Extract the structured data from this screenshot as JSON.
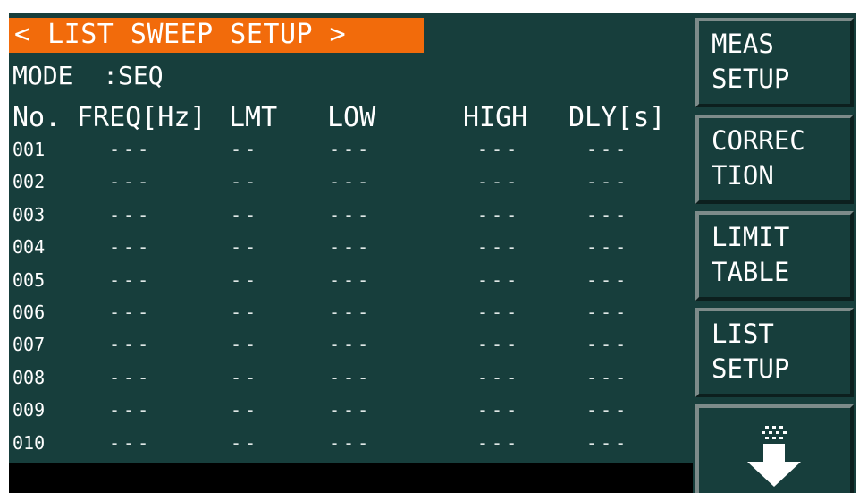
{
  "title": "< LIST SWEEP SETUP >",
  "mode": "MODE  :SEQ",
  "columns": {
    "no": "No.",
    "freq": "FREQ[Hz]",
    "lmt": "LMT",
    "low": "LOW",
    "high": "HIGH",
    "dly": "DLY[s]"
  },
  "rows": [
    {
      "index": "001",
      "freq": "---",
      "lmt": "--",
      "low": "---",
      "high": "---",
      "dly": "---"
    },
    {
      "index": "002",
      "freq": "---",
      "lmt": "--",
      "low": "---",
      "high": "---",
      "dly": "---"
    },
    {
      "index": "003",
      "freq": "---",
      "lmt": "--",
      "low": "---",
      "high": "---",
      "dly": "---"
    },
    {
      "index": "004",
      "freq": "---",
      "lmt": "--",
      "low": "---",
      "high": "---",
      "dly": "---"
    },
    {
      "index": "005",
      "freq": "---",
      "lmt": "--",
      "low": "---",
      "high": "---",
      "dly": "---"
    },
    {
      "index": "006",
      "freq": "---",
      "lmt": "--",
      "low": "---",
      "high": "---",
      "dly": "---"
    },
    {
      "index": "007",
      "freq": "---",
      "lmt": "--",
      "low": "---",
      "high": "---",
      "dly": "---"
    },
    {
      "index": "008",
      "freq": "---",
      "lmt": "--",
      "low": "---",
      "high": "---",
      "dly": "---"
    },
    {
      "index": "009",
      "freq": "---",
      "lmt": "--",
      "low": "---",
      "high": "---",
      "dly": "---"
    },
    {
      "index": "010",
      "freq": "---",
      "lmt": "--",
      "low": "---",
      "high": "---",
      "dly": "---"
    }
  ],
  "softkeys": [
    {
      "line1": "MEAS",
      "line2": "SETUP"
    },
    {
      "line1": "CORREC",
      "line2": "TION"
    },
    {
      "line1": "LIMIT",
      "line2": "TABLE"
    },
    {
      "line1": "LIST",
      "line2": "SETUP"
    },
    {
      "icon": "down-arrow-icon"
    }
  ],
  "colors": {
    "screen_bg": "#173e3c",
    "title_bg": "#f26b0b",
    "text": "#ffffff",
    "status_strip": "#000000"
  }
}
